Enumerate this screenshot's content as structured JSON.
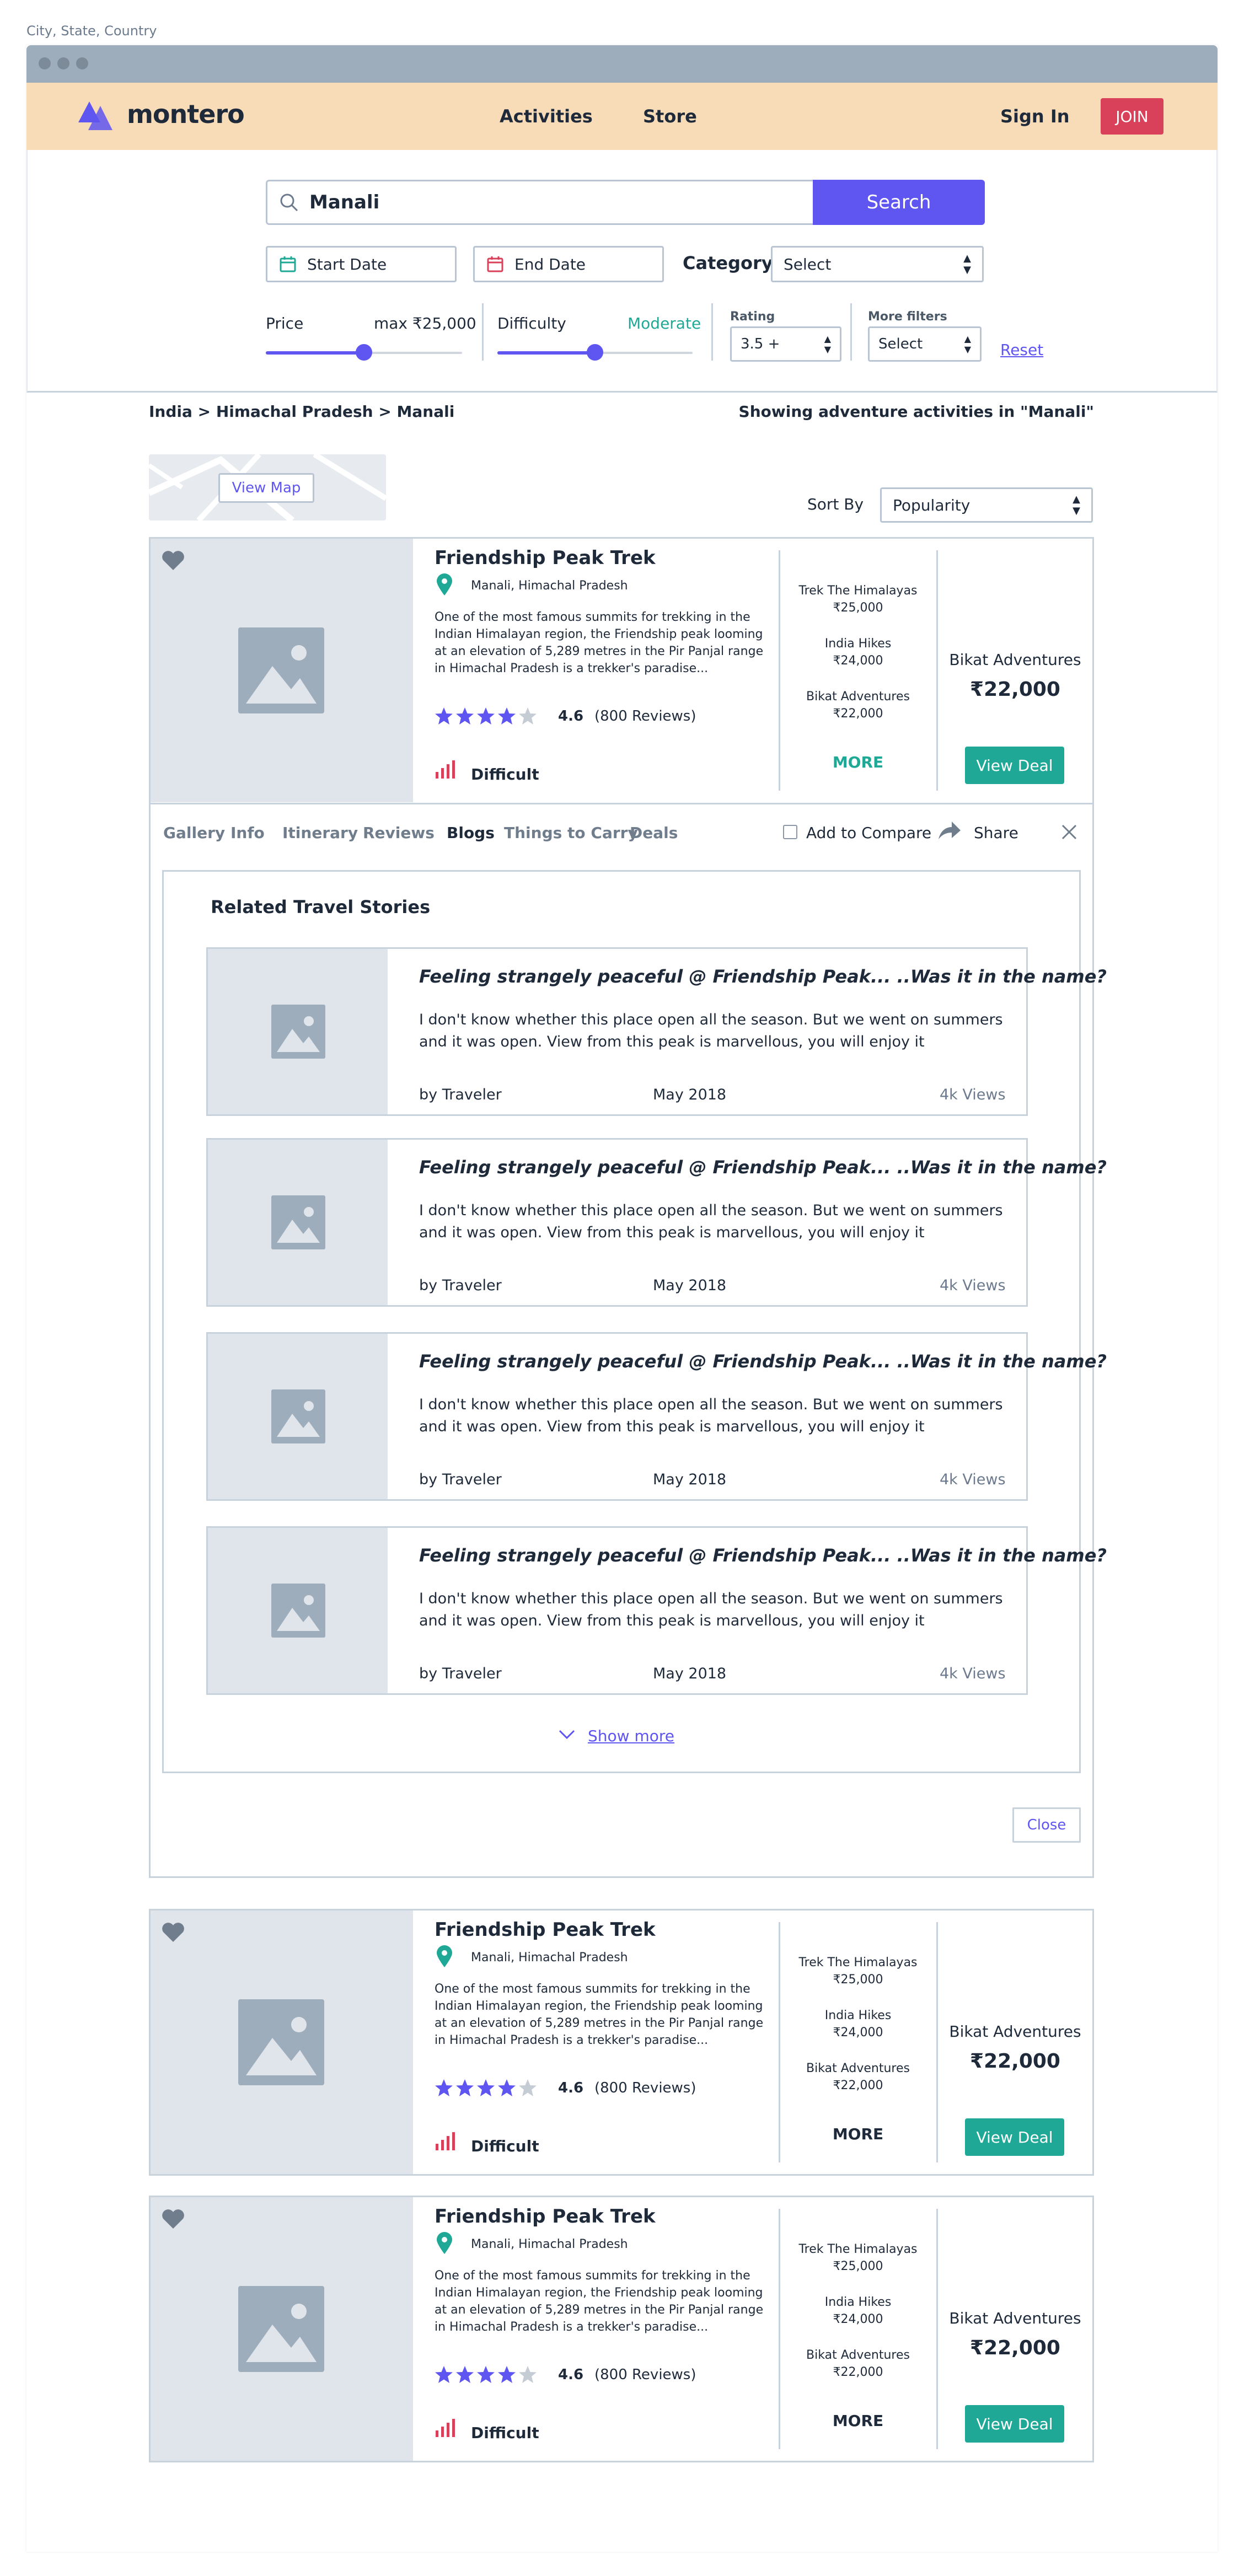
{
  "page_label": "City, State, Country",
  "header": {
    "brand": "montero",
    "nav": [
      "Activities",
      "Store"
    ],
    "sign_in": "Sign In",
    "join": "JOIN"
  },
  "search": {
    "value": "Manali",
    "button": "Search",
    "start_date": "Start Date",
    "end_date": "End Date",
    "category_label": "Category",
    "category_value": "Select",
    "price_label": "Price",
    "price_value": "max ₹25,000",
    "price_fraction": 0.5,
    "difficulty_label": "Difficulty",
    "difficulty_value": "Moderate",
    "difficulty_fraction": 0.5,
    "rating_label": "Rating",
    "rating_value": "3.5 +",
    "more_filters_label": "More filters",
    "more_filters_value": "Select",
    "reset": "Reset"
  },
  "breadcrumb": "India > Himachal Pradesh > Manali",
  "showing_text": "Showing adventure activities in \"Manali\"",
  "view_map": "View Map",
  "sort": {
    "label": "Sort By",
    "value": "Popularity"
  },
  "card": {
    "title": "Friendship Peak Trek",
    "location": "Manali, Himachal Pradesh",
    "description": "One of the most famous summits for trekking in the Indian Himalayan region, the Friendship peak looming at an elevation of 5,289 metres in the Pir Panjal range in Himachal Pradesh is a trekker's paradise...",
    "rating": "4.6",
    "stars": 4,
    "reviews": "(800 Reviews)",
    "difficulty": "Difficult",
    "vendors": [
      {
        "name": "Trek The Himalayas",
        "price": "₹25,000"
      },
      {
        "name": "India Hikes",
        "price": "₹24,000"
      },
      {
        "name": "Bikat Adventures",
        "price": "₹22,000"
      }
    ],
    "more": "MORE",
    "best_vendor": "Bikat Adventures",
    "best_price": "₹22,000",
    "view_deal": "View Deal"
  },
  "tabs": [
    "Gallery",
    "Info",
    "Itinerary",
    "Reviews",
    "Blogs",
    "Things to Carry",
    "Deals"
  ],
  "active_tab": "Blogs",
  "add_to_compare": "Add to Compare",
  "share": "Share",
  "stories": {
    "heading": "Related Travel Stories",
    "items": [
      {
        "title": "Feeling strangely peaceful @ Friendship Peak... ..Was it in the name?",
        "text": "I don't know whether this place open all the season. But we went on summers and it was open. View from this peak is marvellous, you will enjoy it",
        "author": "by Traveler",
        "date": "May 2018",
        "views": "4k Views"
      },
      {
        "title": "Feeling strangely peaceful @ Friendship Peak... ..Was it in the name?",
        "text": "I don't know whether this place open all the season. But we went on summers and it was open. View from this peak is marvellous, you will enjoy it",
        "author": "by Traveler",
        "date": "May 2018",
        "views": "4k Views"
      },
      {
        "title": "Feeling strangely peaceful @ Friendship Peak... ..Was it in the name?",
        "text": "I don't know whether this place open all the season. But we went on summers and it was open. View from this peak is marvellous, you will enjoy it",
        "author": "by Traveler",
        "date": "May 2018",
        "views": "4k Views"
      },
      {
        "title": "Feeling strangely peaceful @ Friendship Peak... ..Was it in the name?",
        "text": "I don't know whether this place open all the season. But we went on summers and it was open. View from this peak is marvellous, you will enjoy it",
        "author": "by Traveler",
        "date": "May 2018",
        "views": "4k Views"
      }
    ],
    "show_more": "Show more"
  },
  "close": "Close",
  "colors": {
    "accent": "#5f55f0",
    "teal": "#1fa896",
    "join": "#d9415a",
    "header_bg": "#f8dcb8",
    "star_off": "#c5ccd4"
  }
}
